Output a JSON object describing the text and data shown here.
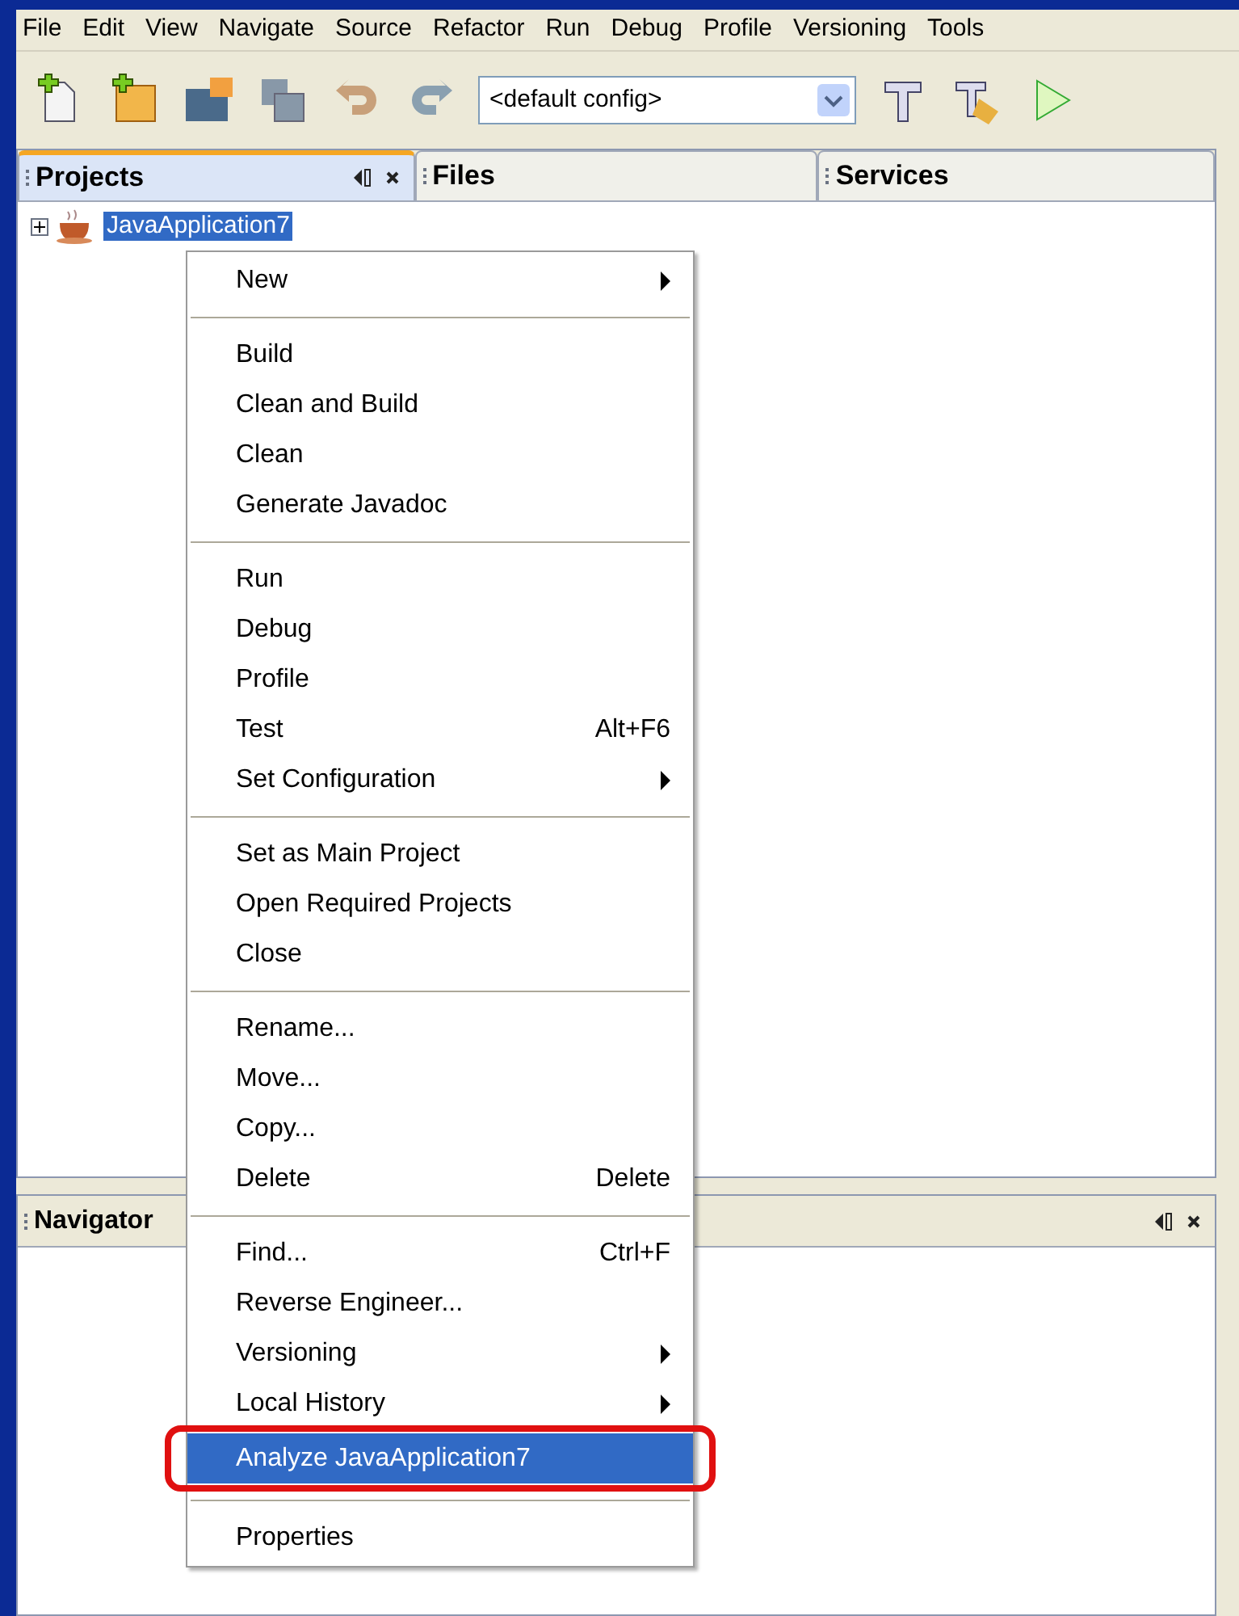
{
  "menu_bar": [
    "File",
    "Edit",
    "View",
    "Navigate",
    "Source",
    "Refactor",
    "Run",
    "Debug",
    "Profile",
    "Versioning",
    "Tools"
  ],
  "toolbar": {
    "config": "<default config>"
  },
  "projects_panel": {
    "tabs": [
      {
        "label": "Projects",
        "selected": true
      },
      {
        "label": "Files",
        "selected": false
      },
      {
        "label": "Services",
        "selected": false
      }
    ],
    "tree": [
      {
        "label": "JavaApplication7",
        "expanded": false,
        "selected": true
      }
    ]
  },
  "navigator_panel": {
    "title": "Navigator"
  },
  "context_menu": [
    [
      {
        "label": "New",
        "kind": "submenu",
        "selected": false
      }
    ],
    [
      {
        "label": "Build",
        "kind": "item",
        "selected": false
      },
      {
        "label": "Clean and Build",
        "kind": "item",
        "selected": false
      },
      {
        "label": "Clean",
        "kind": "item",
        "selected": false
      },
      {
        "label": "Generate Javadoc",
        "kind": "item",
        "selected": false
      }
    ],
    [
      {
        "label": "Run",
        "kind": "item",
        "selected": false
      },
      {
        "label": "Debug",
        "kind": "item",
        "selected": false
      },
      {
        "label": "Profile",
        "kind": "item",
        "selected": false
      },
      {
        "label": "Test",
        "kind": "item",
        "shortcut": "Alt+F6",
        "selected": false
      },
      {
        "label": "Set Configuration",
        "kind": "submenu",
        "selected": false
      }
    ],
    [
      {
        "label": "Set as Main Project",
        "kind": "item",
        "selected": false
      },
      {
        "label": "Open Required Projects",
        "kind": "item",
        "selected": false
      },
      {
        "label": "Close",
        "kind": "item",
        "selected": false
      }
    ],
    [
      {
        "label": "Rename...",
        "kind": "item",
        "selected": false
      },
      {
        "label": "Move...",
        "kind": "item",
        "selected": false
      },
      {
        "label": "Copy...",
        "kind": "item",
        "selected": false
      },
      {
        "label": "Delete",
        "kind": "item",
        "shortcut": "Delete",
        "selected": false
      }
    ],
    [
      {
        "label": "Find...",
        "kind": "item",
        "shortcut": "Ctrl+F",
        "selected": false
      },
      {
        "label": "Reverse Engineer...",
        "kind": "item",
        "selected": false
      },
      {
        "label": "Versioning",
        "kind": "submenu",
        "selected": false
      },
      {
        "label": "Local History",
        "kind": "submenu",
        "selected": false
      },
      {
        "label": "Analyze JavaApplication7",
        "kind": "item",
        "selected": true,
        "highlighted": true
      }
    ],
    [
      {
        "label": "Properties",
        "kind": "item",
        "selected": false
      }
    ]
  ]
}
